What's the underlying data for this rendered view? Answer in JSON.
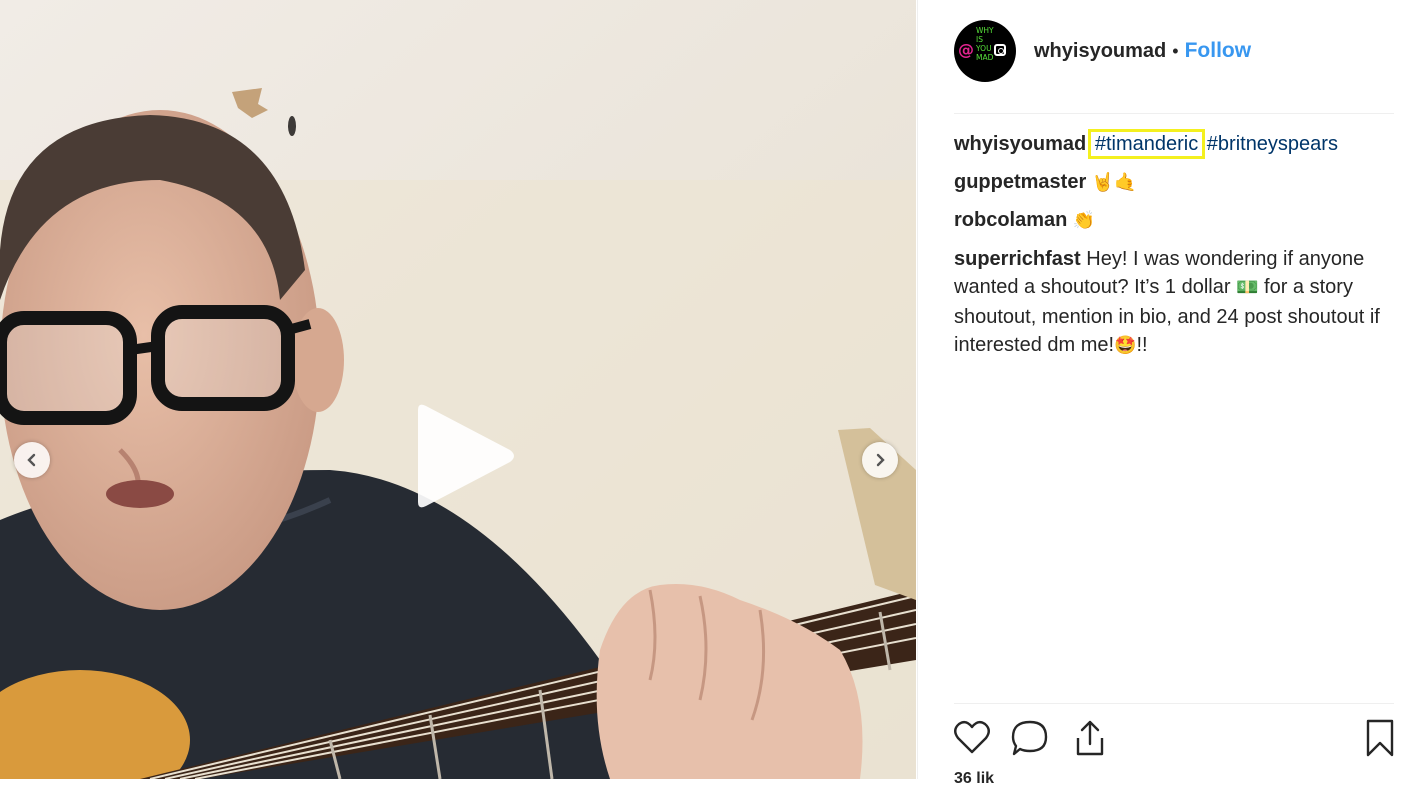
{
  "post": {
    "owner": "whyisyoumad",
    "follow_label": "Follow",
    "separator": "•",
    "avatar": {
      "at": "@",
      "words": [
        "WHY",
        "IS",
        "YOU",
        "MAD"
      ]
    }
  },
  "comments": [
    {
      "user": "whyisyoumad",
      "text": "",
      "tags": [
        "#timanderic",
        "#britneyspears"
      ],
      "emoji": ""
    },
    {
      "user": "guppetmaster",
      "text": "",
      "tags": [],
      "emoji": "🤘🤙"
    },
    {
      "user": "robcolaman",
      "text": "",
      "tags": [],
      "emoji": "👏"
    },
    {
      "user": "superrichfast",
      "text_parts": [
        "Hey! I was wondering if anyone wanted a shoutout? It’s 1 dollar ",
        "💵",
        " for a story shoutout, mention in bio, and 24 post shoutout if interested dm me!",
        "🤩",
        "!!"
      ]
    }
  ],
  "likes_partial": "36 lik",
  "icons": [
    "play-icon",
    "chevron-left-icon",
    "chevron-right-icon",
    "heart-icon",
    "comment-icon",
    "share-icon",
    "bookmark-icon"
  ],
  "colors": {
    "link": "#3897f0",
    "hashtag": "#003569",
    "highlight": "#f4f01f",
    "text": "#262626"
  }
}
